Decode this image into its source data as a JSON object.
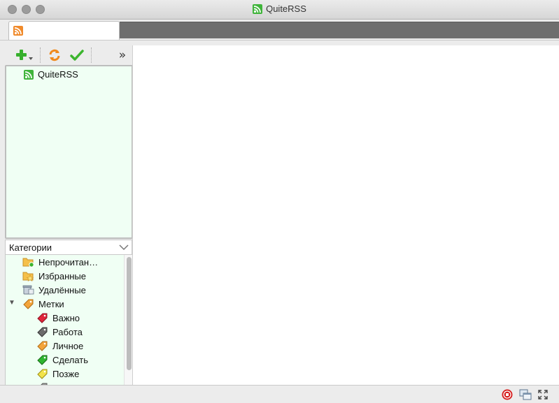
{
  "window": {
    "title": "QuiteRSS"
  },
  "tabs": [
    {
      "label": "",
      "icon": "rss-orange-icon"
    }
  ],
  "toolbar": {
    "add_icon": "add-feed-icon",
    "refresh_icon": "refresh-icon",
    "mark_read_icon": "check-icon",
    "more_icon": "double-chevron-right-icon",
    "more_glyph": "»"
  },
  "feeds": [
    {
      "label": "QuiteRSS",
      "icon": "rss-green-icon"
    }
  ],
  "categories": {
    "header": "Категории",
    "items": [
      {
        "label": "Непрочитан…",
        "icon": "unread-folder-icon"
      },
      {
        "label": "Избранные",
        "icon": "starred-folder-icon"
      },
      {
        "label": "Удалённые",
        "icon": "trash-icon"
      },
      {
        "label": "Метки",
        "icon": "labels-icon",
        "expanded": true
      },
      {
        "label": "Важно",
        "icon": "red-tag-icon",
        "color": "#e0243a"
      },
      {
        "label": "Работа",
        "icon": "gray-tag-icon",
        "color": "#6b6b6b"
      },
      {
        "label": "Личное",
        "icon": "orange-tag-icon",
        "color": "#f3a43a"
      },
      {
        "label": "Сделать",
        "icon": "green-tag-icon",
        "color": "#2fb52f"
      },
      {
        "label": "Позже",
        "icon": "yellow-tag-icon",
        "color": "#f2e34a"
      }
    ]
  },
  "statusbar": {
    "stop_icon": "stop-icon",
    "window_icon": "window-mode-icon",
    "fullscreen_icon": "fullscreen-icon"
  },
  "colors": {
    "tree_background": "#f0fff4",
    "rss_green": "#3fb43a",
    "rss_orange": "#f08a2b"
  }
}
